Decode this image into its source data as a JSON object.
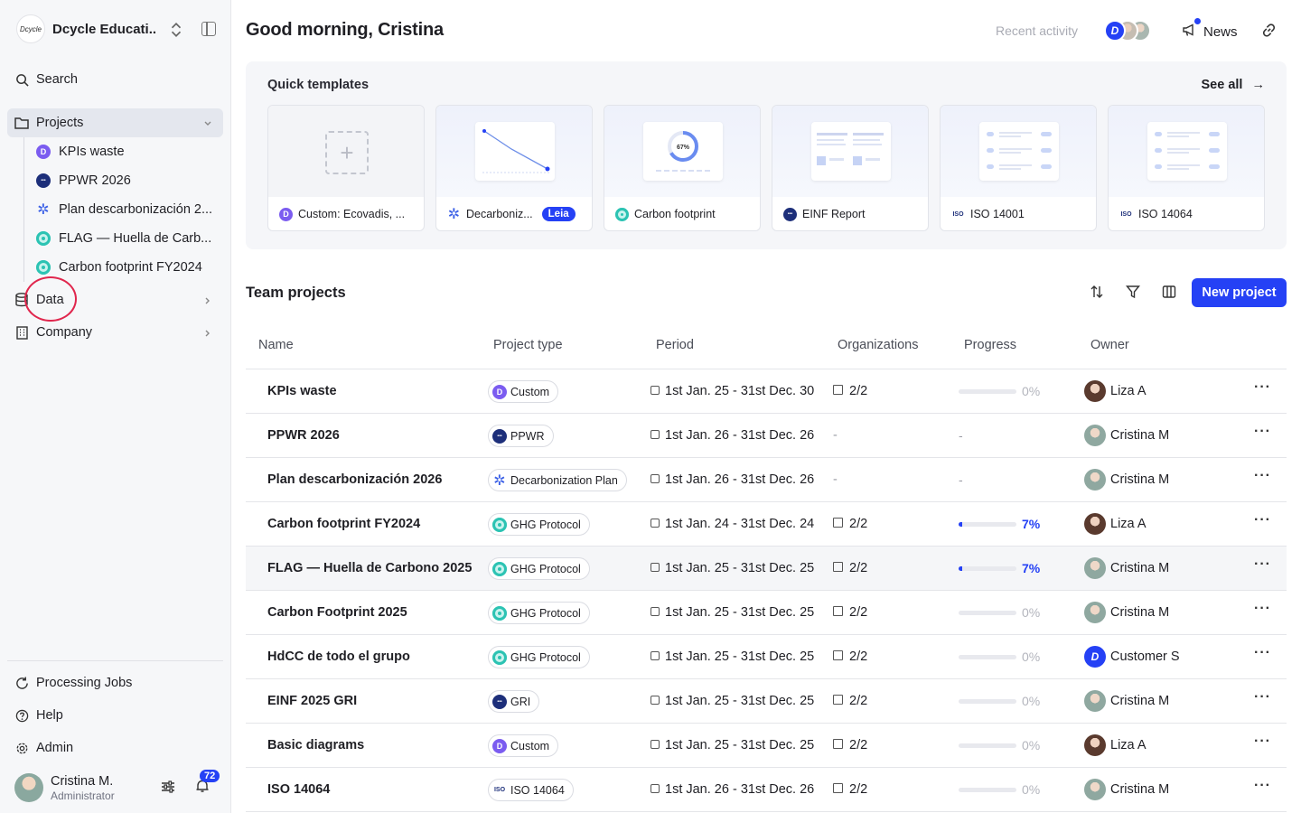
{
  "sidebar": {
    "org_name": "Dcycle Educati...",
    "org_logo_text": "Dcycle",
    "search": "Search",
    "projects": "Projects",
    "project_items": [
      {
        "label": "KPIs waste",
        "icon": "custom"
      },
      {
        "label": "PPWR 2026",
        "icon": "pp"
      },
      {
        "label": "Plan descarbonización 2...",
        "icon": "dec"
      },
      {
        "label": "FLAG — Huella de Carb...",
        "icon": "ghg"
      },
      {
        "label": "Carbon footprint FY2024",
        "icon": "ghg"
      }
    ],
    "data": "Data",
    "company": "Company",
    "processing_jobs": "Processing Jobs",
    "help": "Help",
    "admin": "Admin",
    "user_name": "Cristina M.",
    "user_role": "Administrator",
    "notifications": "72"
  },
  "header": {
    "greeting": "Good morning, Cristina",
    "recent_activity": "Recent activity",
    "news": "News"
  },
  "quick_templates": {
    "title": "Quick templates",
    "see_all": "See all",
    "cards": [
      {
        "label": "Custom: Ecovadis, ...",
        "icon": "custom"
      },
      {
        "label": "Decarboniz...",
        "icon": "dec",
        "badge": "Leia"
      },
      {
        "label": "Carbon footprint",
        "icon": "ghg",
        "thumb_text": "67%"
      },
      {
        "label": "EINF Report",
        "icon": "pp"
      },
      {
        "label": "ISO 14001",
        "icon": "iso"
      },
      {
        "label": "ISO 14064",
        "icon": "iso"
      }
    ]
  },
  "team_projects": {
    "title": "Team projects",
    "new_project": "New project",
    "columns": [
      "Name",
      "Project type",
      "Period",
      "Organizations",
      "Progress",
      "Owner"
    ],
    "rows": [
      {
        "name": "KPIs waste",
        "type": "Custom",
        "icon": "custom",
        "period": "1st Jan. 25 - 31st Dec. 30",
        "orgs": "2/2",
        "progress": "0%",
        "progress_value": 0,
        "owner": "Liza A",
        "owner_av": "liza"
      },
      {
        "name": "PPWR 2026",
        "type": "PPWR",
        "icon": "pp",
        "period": "1st Jan. 26 - 31st Dec. 26",
        "orgs": "-",
        "progress": "-",
        "progress_value": null,
        "owner": "Cristina M",
        "owner_av": "cristina"
      },
      {
        "name": "Plan descarbonización 2026",
        "type": "Decarbonization Plan",
        "icon": "dec",
        "period": "1st Jan. 26 - 31st Dec. 26",
        "orgs": "-",
        "progress": "-",
        "progress_value": null,
        "owner": "Cristina M",
        "owner_av": "cristina"
      },
      {
        "name": "Carbon footprint FY2024",
        "type": "GHG Protocol",
        "icon": "ghg",
        "period": "1st Jan. 24 - 31st Dec. 24",
        "orgs": "2/2",
        "progress": "7%",
        "progress_value": 7,
        "owner": "Liza A",
        "owner_av": "liza"
      },
      {
        "name": "FLAG — Huella de Carbono 2025",
        "type": "GHG Protocol",
        "icon": "ghg",
        "period": "1st Jan. 25 - 31st Dec. 25",
        "orgs": "2/2",
        "progress": "7%",
        "progress_value": 7,
        "owner": "Cristina M",
        "owner_av": "cristina",
        "highlight": true
      },
      {
        "name": "Carbon Footprint 2025",
        "type": "GHG Protocol",
        "icon": "ghg",
        "period": "1st Jan. 25 - 31st Dec. 25",
        "orgs": "2/2",
        "progress": "0%",
        "progress_value": 0,
        "owner": "Cristina M",
        "owner_av": "cristina"
      },
      {
        "name": "HdCC de todo el grupo",
        "type": "GHG Protocol",
        "icon": "ghg",
        "period": "1st Jan. 25 - 31st Dec. 25",
        "orgs": "2/2",
        "progress": "0%",
        "progress_value": 0,
        "owner": "Customer S",
        "owner_av": "cust"
      },
      {
        "name": "EINF 2025 GRI",
        "type": "GRI",
        "icon": "gri",
        "period": "1st Jan. 25 - 31st Dec. 25",
        "orgs": "2/2",
        "progress": "0%",
        "progress_value": 0,
        "owner": "Cristina M",
        "owner_av": "cristina"
      },
      {
        "name": "Basic diagrams",
        "type": "Custom",
        "icon": "custom",
        "period": "1st Jan. 25 - 31st Dec. 25",
        "orgs": "2/2",
        "progress": "0%",
        "progress_value": 0,
        "owner": "Liza A",
        "owner_av": "liza"
      },
      {
        "name": "ISO 14064",
        "type": "ISO 14064",
        "icon": "iso",
        "period": "1st Jan. 26 - 31st Dec. 26",
        "orgs": "2/2",
        "progress": "0%",
        "progress_value": 0,
        "owner": "Cristina M",
        "owner_av": "cristina"
      }
    ]
  },
  "colors": {
    "accent": "#2541f5",
    "highlight": "#e0264d"
  }
}
